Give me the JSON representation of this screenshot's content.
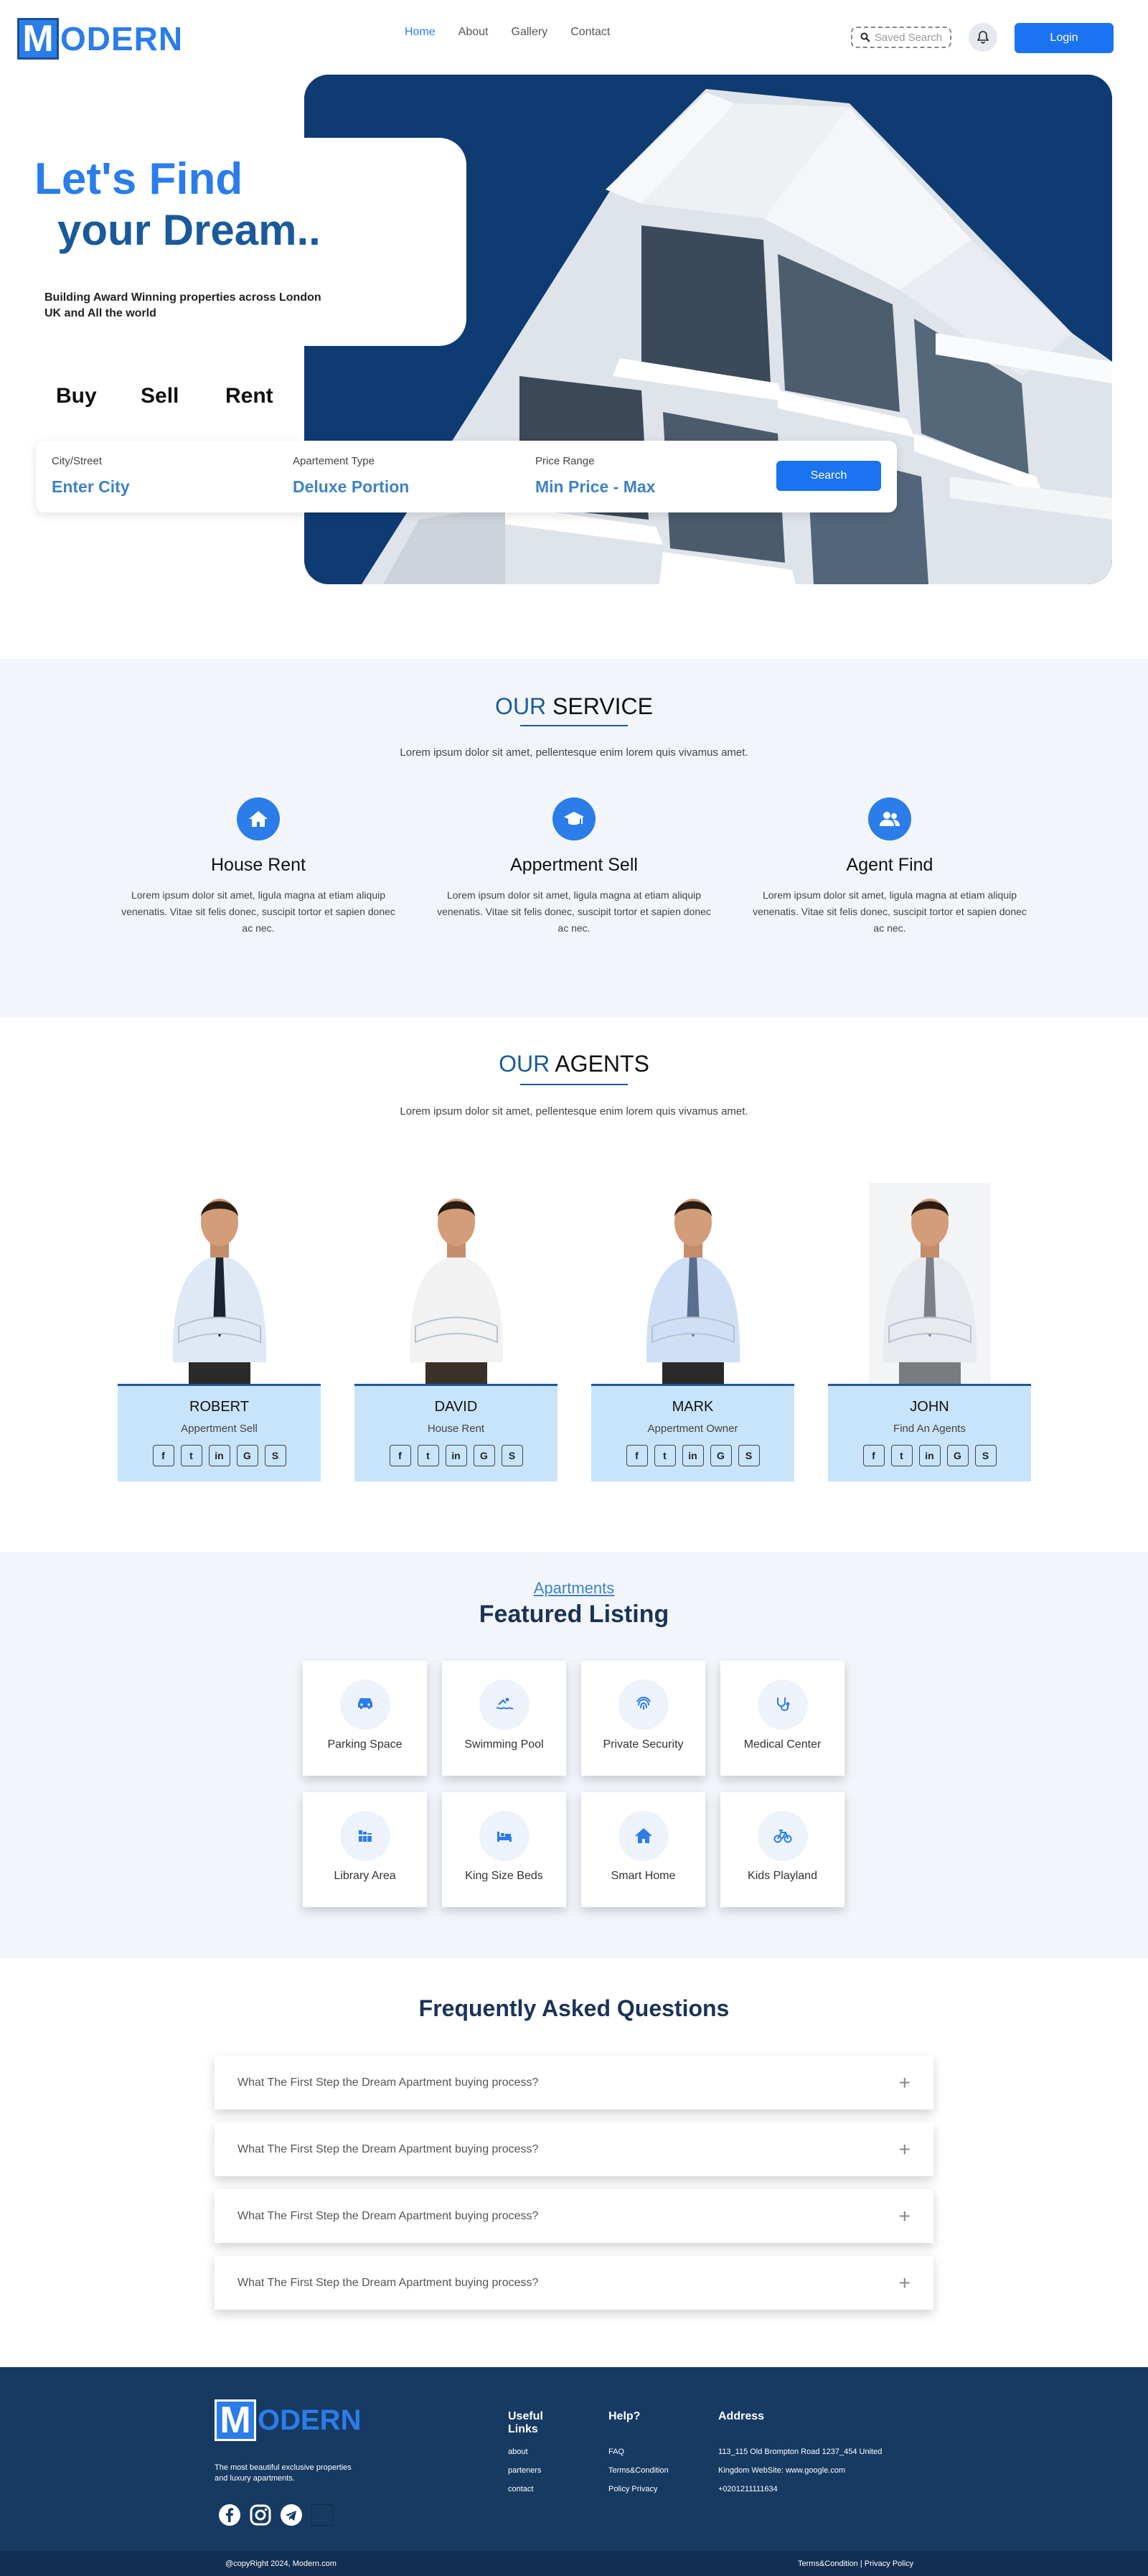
{
  "header": {
    "logo_letter": "M",
    "logo_text": "ODERN",
    "nav": [
      "Home",
      "About",
      "Gallery",
      "Contact"
    ],
    "saved_search": "Saved Search",
    "login": "Login"
  },
  "hero": {
    "title_line1": "Let's Find",
    "title_line2": "your Dream..",
    "subtitle": "Building Award Winning properties across London UK and All the world",
    "tabs": [
      "Buy",
      "Sell",
      "Rent"
    ],
    "search": {
      "city_label": "City/Street",
      "city_value": "Enter City",
      "type_label": "Apartement Type",
      "type_value": "Deluxe Portion",
      "price_label": "Price Range",
      "price_value": "Min Price - Max",
      "button": "Search"
    }
  },
  "services": {
    "title_hl": "OUR",
    "title_rest": " SERVICE",
    "lead": "Lorem ipsum dolor sit amet, pellentesque enim lorem quis vivamus amet.",
    "items": [
      {
        "icon": "home-icon",
        "title": "House Rent",
        "desc": "Lorem ipsum dolor sit amet, ligula magna at etiam aliquip venenatis. Vitae sit felis donec, suscipit tortor et sapien donec ac nec."
      },
      {
        "icon": "graduation-cap-icon",
        "title": "Appertment Sell",
        "desc": "Lorem ipsum dolor sit amet, ligula magna at etiam aliquip venenatis. Vitae sit felis donec, suscipit tortor et sapien donec ac nec."
      },
      {
        "icon": "users-icon",
        "title": "Agent Find",
        "desc": "Lorem ipsum dolor sit amet, ligula magna at etiam aliquip venenatis. Vitae sit felis donec, suscipit tortor et sapien donec ac nec."
      }
    ]
  },
  "agents": {
    "title_hl": "OUR",
    "title_rest": " AGENTS",
    "lead": "Lorem ipsum dolor sit amet, pellentesque enim lorem quis vivamus amet.",
    "items": [
      {
        "name": "ROBERT",
        "role": "Appertment Sell"
      },
      {
        "name": "DAVID",
        "role": "House Rent"
      },
      {
        "name": "MARK",
        "role": "Appertment Owner"
      },
      {
        "name": "JOHN",
        "role": "Find An Agents"
      }
    ],
    "social": [
      "f",
      "t",
      "in",
      "G",
      "S"
    ]
  },
  "featured": {
    "kicker": "Apartments",
    "title": "Featured Listing",
    "items": [
      {
        "icon": "car-icon",
        "label": "Parking Space"
      },
      {
        "icon": "swimmer-icon",
        "label": "Swimming Pool"
      },
      {
        "icon": "fingerprint-icon",
        "label": "Private Security"
      },
      {
        "icon": "stethoscope-icon",
        "label": "Medical Center"
      },
      {
        "icon": "book-icon",
        "label": "Library Area"
      },
      {
        "icon": "bed-icon",
        "label": "King Size Beds"
      },
      {
        "icon": "home-icon",
        "label": "Smart Home"
      },
      {
        "icon": "bicycle-icon",
        "label": "Kids Playland"
      }
    ]
  },
  "faq": {
    "title": "Frequently Asked Questions",
    "items": [
      "What The First Step the Dream Apartment buying process?",
      "What The First Step the Dream Apartment buying process?",
      "What The First Step the Dream Apartment buying process?",
      "What The First Step the Dream Apartment buying process?"
    ]
  },
  "footer": {
    "tagline": "The most beautiful exclusive properties and luxury apartments.",
    "useful_links_title": "Useful Links",
    "useful_links": [
      "about",
      "parteners",
      "contact"
    ],
    "help_title": "Help?",
    "help_links": [
      "FAQ",
      "Terms&Condition",
      "Policy  Privacy"
    ],
    "address_title": "Address",
    "address_lines": [
      "113_115 Old Brompton Road  1237_454 United",
      "Kingdom  WebSite: www.google.com",
      "+0201211111634"
    ],
    "copyright": "@copyRight 2024, Modern.com",
    "legal": "Terms&Condition | Privacy Policy"
  },
  "colors": {
    "primary": "#1a73f0",
    "accent": "#2b7de9",
    "dark_blue": "#1b5a9a",
    "footer": "#173a62",
    "agent_card": "#c8e4fb"
  }
}
